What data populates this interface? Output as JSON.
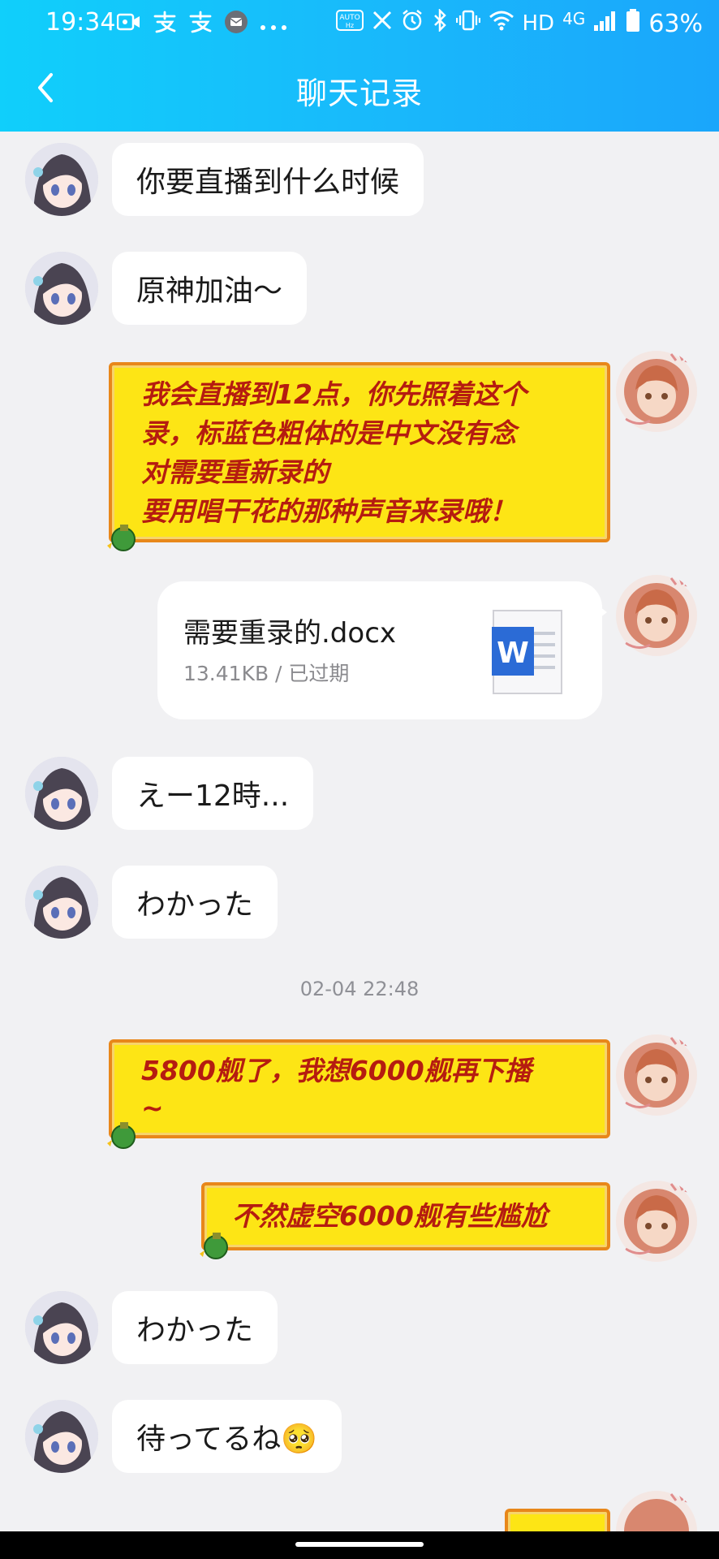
{
  "status_bar": {
    "time": "19:34",
    "left_icons": [
      "video-icon",
      "alipay-icon",
      "alipay-icon",
      "message-icon",
      "more-dots"
    ],
    "right_icons": [
      "auto-hz-icon",
      "x-icon",
      "alarm-icon",
      "bluetooth-icon",
      "vibrate-icon",
      "wifi-icon"
    ],
    "hd_label": "HD",
    "network_label": "4G",
    "battery_percent": "63%"
  },
  "header": {
    "title": "聊天记录",
    "back_icon": "chevron-left-icon"
  },
  "messages": [
    {
      "side": "left",
      "type": "text",
      "text": "你要直播到什么时候"
    },
    {
      "side": "left",
      "type": "text",
      "text": "原神加油～"
    },
    {
      "side": "right",
      "type": "styled",
      "lines": [
        "我会直播到12点，你先照着这个",
        "录，标蓝色粗体的是中文没有念",
        "对需要重新录的",
        "要用唱干花的那种声音来录哦！"
      ]
    },
    {
      "side": "right",
      "type": "file",
      "file_name": "需要重录的.docx",
      "file_meta": "13.41KB / 已过期",
      "file_icon": "word-icon"
    },
    {
      "side": "left",
      "type": "text",
      "text": "えー12時..."
    },
    {
      "side": "left",
      "type": "text",
      "text": "わかった"
    },
    {
      "type": "timestamp",
      "text": "02-04 22:48"
    },
    {
      "side": "right",
      "type": "styled",
      "lines": [
        "5800舰了，我想6000舰再下播",
        "~"
      ]
    },
    {
      "side": "right",
      "type": "styled",
      "lines": [
        "不然虚空6000舰有些尴尬"
      ]
    },
    {
      "side": "left",
      "type": "text",
      "text": "わかった"
    },
    {
      "side": "left",
      "type": "text",
      "text": "待ってるね🥺"
    }
  ],
  "colors": {
    "header_gradient_start": "#10cffb",
    "header_gradient_end": "#1aa6fb",
    "styled_bubble_fill": "#fde515",
    "styled_bubble_border": "#e8871a",
    "styled_bubble_text": "#b51c10",
    "page_background": "#f1f1f3"
  }
}
